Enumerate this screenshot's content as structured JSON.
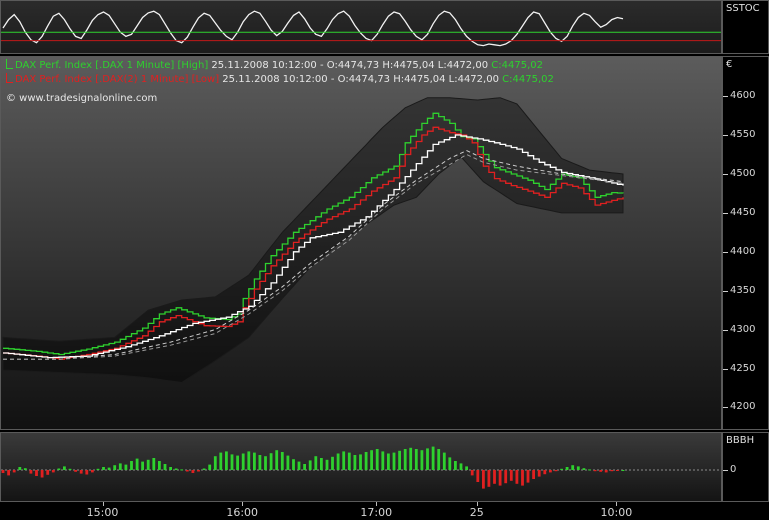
{
  "panels": {
    "stoch": {
      "label": "SSTOC"
    },
    "main": {
      "label": "€",
      "watermark": "© www.tradesignalonline.com",
      "legend": [
        {
          "name": "DAX Perf. Index [.DAX  1 Minute] [High]",
          "date": "25.11.2008 10:12:00",
          "ohl": "- O:4474,73 H:4475,04 L:4472,00",
          "close": "C:4475,02",
          "color": "#2ed12e"
        },
        {
          "name": "DAX Perf. Index [.DAX(2)  1 Minute] [Low]",
          "date": "25.11.2008 10:12:00",
          "ohl": "- O:4474,73 H:4475,04 L:4472,00",
          "close": "C:4475,02",
          "color": "#e02020"
        }
      ]
    },
    "bbbh": {
      "label": "BBBH",
      "zero_label": "0"
    }
  },
  "chart_data": [
    {
      "type": "line",
      "title": "",
      "y_axis_label": "€",
      "ylim": [
        4180,
        4640
      ],
      "y_ticks": [
        4200,
        4250,
        4300,
        4350,
        4400,
        4450,
        4500,
        4550,
        4600
      ],
      "x_ticks": [
        "15:00",
        "16:00",
        "17:00",
        "25",
        "10:00"
      ],
      "x_tick_index": [
        18,
        43,
        67,
        85,
        110
      ],
      "n_points": 112,
      "grid": false,
      "series": [
        {
          "name": "DAX Perf. Index [.DAX  1 Minute] [High]",
          "color": "#2ed12e",
          "style": "step",
          "anchors": [
            [
              0,
              4276
            ],
            [
              6,
              4272
            ],
            [
              10,
              4268
            ],
            [
              15,
              4275
            ],
            [
              20,
              4284
            ],
            [
              25,
              4302
            ],
            [
              28,
              4320
            ],
            [
              31,
              4328
            ],
            [
              36,
              4315
            ],
            [
              40,
              4313
            ],
            [
              42,
              4320
            ],
            [
              43,
              4340
            ],
            [
              45,
              4365
            ],
            [
              48,
              4395
            ],
            [
              52,
              4425
            ],
            [
              55,
              4440
            ],
            [
              58,
              4455
            ],
            [
              62,
              4470
            ],
            [
              66,
              4495
            ],
            [
              70,
              4510
            ],
            [
              72,
              4540
            ],
            [
              75,
              4565
            ],
            [
              77,
              4578
            ],
            [
              80,
              4565
            ],
            [
              82,
              4548
            ],
            [
              84,
              4545
            ],
            [
              86,
              4525
            ],
            [
              88,
              4508
            ],
            [
              91,
              4500
            ],
            [
              94,
              4492
            ],
            [
              97,
              4480
            ],
            [
              100,
              4500
            ],
            [
              103,
              4495
            ],
            [
              106,
              4470
            ],
            [
              109,
              4476
            ],
            [
              111,
              4475
            ]
          ]
        },
        {
          "name": "DAX Perf. Index [.DAX(2)  1 Minute] [Low]",
          "color": "#e02020",
          "style": "step",
          "anchors": [
            [
              0,
              4270
            ],
            [
              6,
              4266
            ],
            [
              10,
              4262
            ],
            [
              15,
              4268
            ],
            [
              20,
              4276
            ],
            [
              25,
              4292
            ],
            [
              28,
              4310
            ],
            [
              31,
              4318
            ],
            [
              36,
              4305
            ],
            [
              40,
              4304
            ],
            [
              42,
              4310
            ],
            [
              43,
              4328
            ],
            [
              45,
              4352
            ],
            [
              48,
              4382
            ],
            [
              52,
              4412
            ],
            [
              55,
              4428
            ],
            [
              58,
              4442
            ],
            [
              62,
              4455
            ],
            [
              66,
              4478
            ],
            [
              70,
              4495
            ],
            [
              72,
              4525
            ],
            [
              75,
              4550
            ],
            [
              77,
              4560
            ],
            [
              80,
              4553
            ],
            [
              82,
              4550
            ],
            [
              84,
              4540
            ],
            [
              86,
              4510
            ],
            [
              88,
              4494
            ],
            [
              91,
              4485
            ],
            [
              94,
              4478
            ],
            [
              97,
              4470
            ],
            [
              100,
              4488
            ],
            [
              103,
              4482
            ],
            [
              106,
              4460
            ],
            [
              109,
              4466
            ],
            [
              111,
              4470
            ]
          ]
        },
        {
          "name": "",
          "color": "#ffffff",
          "style": "step",
          "anchors": [
            [
              0,
              4270
            ],
            [
              8,
              4264
            ],
            [
              15,
              4266
            ],
            [
              22,
              4278
            ],
            [
              28,
              4292
            ],
            [
              34,
              4308
            ],
            [
              40,
              4316
            ],
            [
              44,
              4330
            ],
            [
              48,
              4360
            ],
            [
              52,
              4400
            ],
            [
              55,
              4418
            ],
            [
              60,
              4425
            ],
            [
              65,
              4445
            ],
            [
              70,
              4480
            ],
            [
              73,
              4505
            ],
            [
              77,
              4538
            ],
            [
              81,
              4550
            ],
            [
              85,
              4545
            ],
            [
              88,
              4540
            ],
            [
              92,
              4532
            ],
            [
              96,
              4515
            ],
            [
              100,
              4502
            ],
            [
              105,
              4495
            ],
            [
              111,
              4485
            ]
          ]
        },
        {
          "name": "",
          "color": "#cfcfcf",
          "style": "dashed",
          "anchors": [
            [
              0,
              4262
            ],
            [
              10,
              4262
            ],
            [
              20,
              4268
            ],
            [
              30,
              4284
            ],
            [
              38,
              4300
            ],
            [
              44,
              4325
            ],
            [
              50,
              4355
            ],
            [
              55,
              4385
            ],
            [
              62,
              4420
            ],
            [
              68,
              4460
            ],
            [
              74,
              4492
            ],
            [
              80,
              4520
            ],
            [
              83,
              4530
            ],
            [
              86,
              4520
            ],
            [
              92,
              4510
            ],
            [
              100,
              4500
            ],
            [
              111,
              4490
            ]
          ]
        },
        {
          "name": "",
          "color": "#9a9a9a",
          "style": "dashed",
          "anchors": [
            [
              0,
              4262
            ],
            [
              10,
              4262
            ],
            [
              20,
              4266
            ],
            [
              30,
              4280
            ],
            [
              38,
              4295
            ],
            [
              44,
              4320
            ],
            [
              50,
              4350
            ],
            [
              55,
              4380
            ],
            [
              62,
              4415
            ],
            [
              68,
              4455
            ],
            [
              74,
              4488
            ],
            [
              80,
              4512
            ],
            [
              83,
              4525
            ],
            [
              86,
              4515
            ],
            [
              92,
              4505
            ],
            [
              100,
              4498
            ],
            [
              111,
              4488
            ]
          ]
        },
        {
          "name": "",
          "color": "#101010",
          "style": "band-upper",
          "anchors": [
            [
              0,
              4290
            ],
            [
              10,
              4285
            ],
            [
              20,
              4290
            ],
            [
              26,
              4325
            ],
            [
              32,
              4338
            ],
            [
              38,
              4342
            ],
            [
              44,
              4370
            ],
            [
              50,
              4425
            ],
            [
              56,
              4470
            ],
            [
              62,
              4515
            ],
            [
              68,
              4560
            ],
            [
              72,
              4585
            ],
            [
              76,
              4598
            ],
            [
              80,
              4598
            ],
            [
              85,
              4595
            ],
            [
              89,
              4598
            ],
            [
              92,
              4590
            ],
            [
              96,
              4555
            ],
            [
              100,
              4520
            ],
            [
              105,
              4505
            ],
            [
              111,
              4500
            ]
          ]
        },
        {
          "name": "",
          "color": "#101010",
          "style": "band-lower",
          "anchors": [
            [
              0,
              4248
            ],
            [
              10,
              4245
            ],
            [
              20,
              4242
            ],
            [
              26,
              4238
            ],
            [
              32,
              4232
            ],
            [
              38,
              4260
            ],
            [
              44,
              4290
            ],
            [
              50,
              4340
            ],
            [
              55,
              4380
            ],
            [
              60,
              4410
            ],
            [
              65,
              4435
            ],
            [
              70,
              4460
            ],
            [
              74,
              4470
            ],
            [
              78,
              4500
            ],
            [
              82,
              4522
            ],
            [
              86,
              4490
            ],
            [
              92,
              4462
            ],
            [
              100,
              4450
            ],
            [
              111,
              4450
            ]
          ]
        }
      ]
    },
    {
      "type": "line",
      "title": "",
      "y_axis_label": "SSTOC",
      "ylim": [
        0,
        100
      ],
      "n_points": 112,
      "grid": false,
      "series": [
        {
          "name": "",
          "color": "#f2f2f2",
          "style": "line",
          "values": [
            50,
            70,
            82,
            65,
            40,
            22,
            15,
            30,
            55,
            78,
            85,
            70,
            48,
            30,
            25,
            45,
            68,
            82,
            88,
            80,
            60,
            40,
            30,
            35,
            55,
            75,
            86,
            90,
            82,
            60,
            38,
            20,
            15,
            28,
            52,
            74,
            85,
            80,
            62,
            44,
            30,
            22,
            40,
            65,
            82,
            90,
            85,
            66,
            45,
            32,
            42,
            62,
            80,
            88,
            72,
            50,
            35,
            30,
            48,
            70,
            84,
            90,
            78,
            56,
            38,
            25,
            20,
            35,
            58,
            78,
            88,
            84,
            66,
            46,
            30,
            22,
            35,
            60,
            80,
            90,
            86,
            70,
            48,
            30,
            18,
            10,
            8,
            12,
            10,
            8,
            12,
            20,
            35,
            55,
            75,
            88,
            84,
            62,
            40,
            25,
            18,
            30,
            55,
            75,
            85,
            80,
            65,
            52,
            58,
            70,
            75,
            72
          ]
        },
        {
          "name": "",
          "color": "#2ed12e",
          "style": "flat",
          "values_const": 40
        },
        {
          "name": "",
          "color": "#c01818",
          "style": "flat",
          "values_const": 20
        }
      ]
    },
    {
      "type": "bar",
      "title": "",
      "y_axis_label": "BBBH",
      "y_ticks": [
        0
      ],
      "ylim": [
        -1,
        1
      ],
      "n_points": 112,
      "series": [
        {
          "name": "",
          "color_pos": "#2ed12e",
          "color_neg": "#e02020",
          "values": [
            -0.1,
            -0.18,
            -0.08,
            0.1,
            0.06,
            -0.12,
            -0.2,
            -0.25,
            -0.16,
            -0.08,
            0.05,
            0.12,
            0.04,
            -0.06,
            -0.12,
            -0.15,
            -0.08,
            0.04,
            0.1,
            0.08,
            0.16,
            0.22,
            0.18,
            0.3,
            0.38,
            0.28,
            0.34,
            0.4,
            0.3,
            0.2,
            0.1,
            0.05,
            0.02,
            -0.05,
            -0.1,
            -0.05,
            0.05,
            0.18,
            0.46,
            0.58,
            0.62,
            0.52,
            0.48,
            0.55,
            0.62,
            0.58,
            0.5,
            0.46,
            0.56,
            0.66,
            0.6,
            0.48,
            0.36,
            0.28,
            0.2,
            0.32,
            0.46,
            0.4,
            0.34,
            0.44,
            0.55,
            0.62,
            0.58,
            0.5,
            0.52,
            0.6,
            0.66,
            0.7,
            0.62,
            0.55,
            0.58,
            0.64,
            0.7,
            0.74,
            0.7,
            0.66,
            0.72,
            0.78,
            0.7,
            0.58,
            0.42,
            0.3,
            0.22,
            0.12,
            -0.18,
            -0.4,
            -0.62,
            -0.56,
            -0.46,
            -0.52,
            -0.44,
            -0.36,
            -0.46,
            -0.52,
            -0.42,
            -0.3,
            -0.22,
            -0.14,
            -0.08,
            -0.04,
            0.04,
            0.1,
            0.16,
            0.12,
            0.06,
            0.02,
            -0.04,
            -0.06,
            -0.08,
            -0.04,
            -0.02,
            0.0
          ]
        }
      ]
    }
  ]
}
